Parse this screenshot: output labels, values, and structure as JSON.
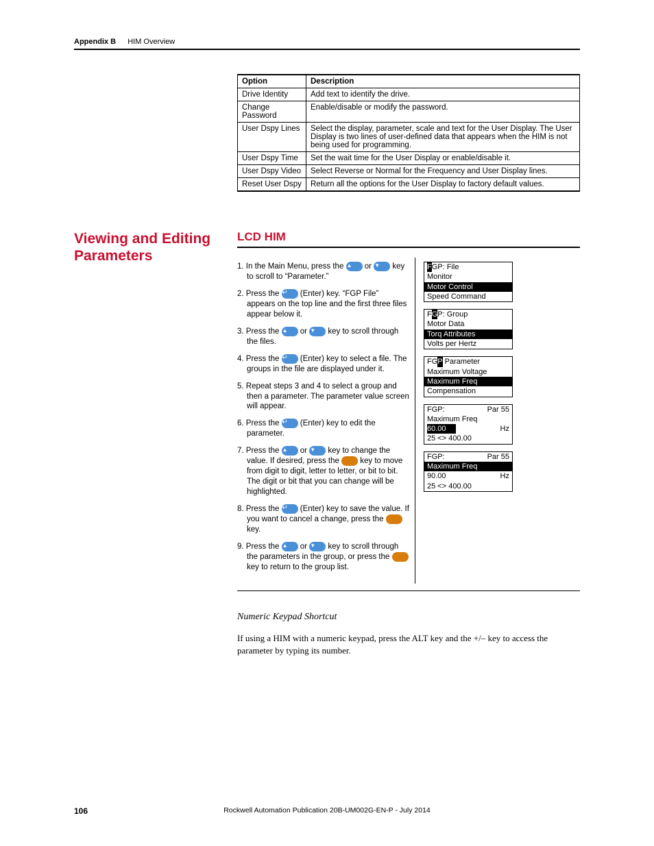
{
  "header": {
    "appendix": "Appendix B",
    "title": "HIM Overview"
  },
  "table": {
    "headers": [
      "Option",
      "Description"
    ],
    "rows": [
      [
        "Drive Identity",
        "Add text to identify the drive."
      ],
      [
        "Change Password",
        "Enable/disable or modify the password."
      ],
      [
        "User Dspy Lines",
        "Select the display, parameter, scale and text for the User Display. The User Display is two lines of user-defined data that appears when the HIM is not being used for programming."
      ],
      [
        "User Dspy Time",
        "Set the wait time for the User Display or enable/disable it."
      ],
      [
        "User Dspy Video",
        "Select Reverse or Normal for the Frequency and User Display lines."
      ],
      [
        "Reset User Dspy",
        "Return all the options for the User Display to factory default values."
      ]
    ]
  },
  "side_heading": "Viewing and Editing Parameters",
  "sub_heading": "LCD HIM",
  "steps": [
    {
      "pre": "In the Main Menu, press the ",
      "key1": "up",
      "mid": " or ",
      "key2": "down",
      "post": " key to scroll to “Parameter.”"
    },
    {
      "pre": "Press the ",
      "key1": "enter",
      "post": " (Enter) key. “FGP File” appears on the top line and the first three files appear below it."
    },
    {
      "pre": "Press the ",
      "key1": "up",
      "mid": " or ",
      "key2": "down",
      "post": " key to scroll through the files."
    },
    {
      "pre": "Press the ",
      "key1": "enter",
      "post": " (Enter) key to select a file. The groups in the file are displayed under it."
    },
    {
      "plain": "Repeat steps 3 and 4 to select a group and then a parameter. The parameter value screen will appear."
    },
    {
      "pre": "Press the ",
      "key1": "enter",
      "post": " (Enter) key to edit the parameter."
    },
    {
      "pre": "Press the ",
      "key1": "up",
      "mid": " or ",
      "key2": "down",
      "post": " key to change the value. If desired, press the ",
      "key3": "sel",
      "post2": " key to move from digit to digit, letter to letter, or bit to bit. The digit or bit that you can change will be highlighted."
    },
    {
      "pre": "Press the ",
      "key1": "enter",
      "post": " (Enter) key to save the value. If you want to cancel a change, press the ",
      "key3": "sel",
      "post2": " key."
    },
    {
      "pre": "Press the ",
      "key1": "up",
      "mid": " or ",
      "key2": "down",
      "post": " key to scroll through the parameters in the group, or press the ",
      "key3": "sel",
      "post2": " key to return to the group list."
    }
  ],
  "screens": {
    "file": {
      "title_pre": "F",
      "title_post": "GP: File",
      "items": [
        "Monitor",
        "Motor Control",
        "Speed Command"
      ],
      "hl_index": 1
    },
    "group": {
      "title_pre": "F",
      "title_mid": "G",
      "title_post": "P: Group",
      "items": [
        "Motor Data",
        "Torq Attributes",
        "Volts per Hertz"
      ],
      "hl_index": 1
    },
    "param": {
      "title_plain": "FG",
      "title_cur": "P",
      "title_rest": " Parameter",
      "items": [
        "Maximum Voltage",
        "Maximum Freq",
        "Compensation"
      ],
      "hl_index": 1
    },
    "value1": {
      "fgp": "FGP:",
      "par": "Par 55",
      "name": "Maximum Freq",
      "val": "60.00",
      "unit": "Hz",
      "range": "25 <> 400.00"
    },
    "value2": {
      "fgp": "FGP:",
      "par": "Par 55",
      "name": "Maximum Freq",
      "val": "90.00",
      "unit": "Hz",
      "range": "25 <> 400.00",
      "hl_name": true
    }
  },
  "subsection_title": "Numeric Keypad Shortcut",
  "body_text": "If using a HIM with a numeric keypad, press the ALT key and the +/– key to access the parameter by typing its number.",
  "footer": {
    "page": "106",
    "pub": "Rockwell Automation Publication 20B-UM002G-EN-P - July 2014"
  }
}
